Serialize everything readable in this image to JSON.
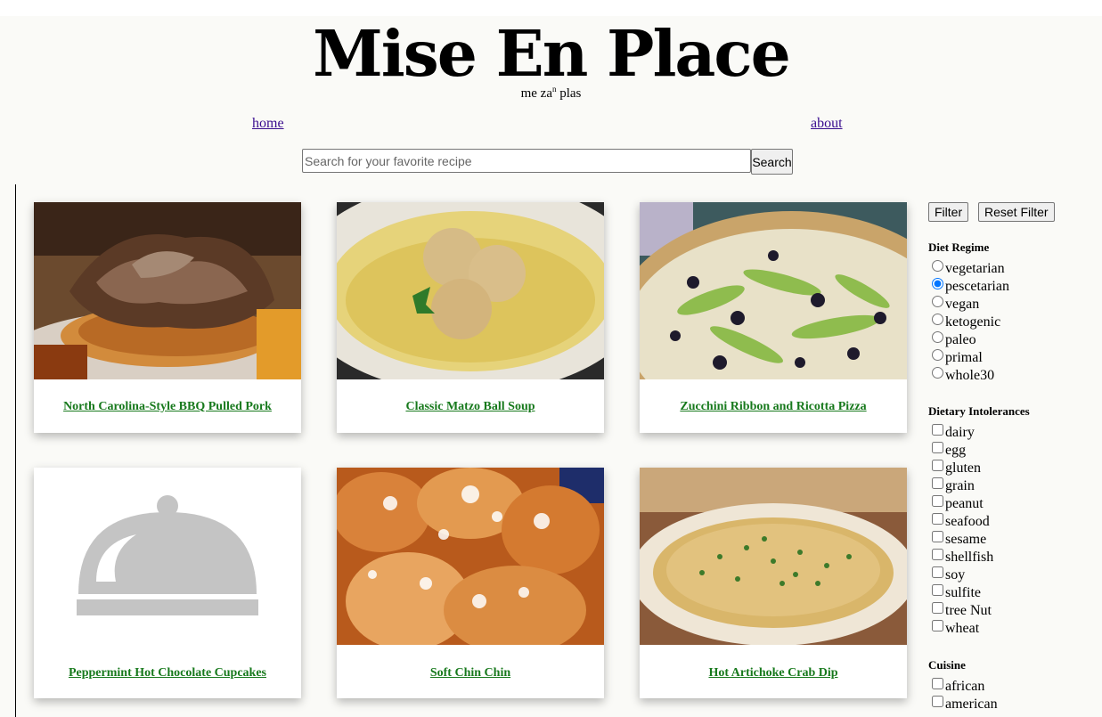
{
  "header": {
    "title": "Mise En Place",
    "pronunciation_main": "me za",
    "pronunciation_sup": "n",
    "pronunciation_end": "plas"
  },
  "nav": {
    "home": "home",
    "about": "about"
  },
  "search": {
    "placeholder": "Search for your favorite recipe",
    "value": "",
    "button": "Search"
  },
  "recipes": [
    {
      "title": "North Carolina-Style BBQ Pulled Pork",
      "image": "pulled-pork-photo"
    },
    {
      "title": "Classic Matzo Ball Soup",
      "image": "matzo-ball-soup-photo"
    },
    {
      "title": "Zucchini Ribbon and Ricotta Pizza",
      "image": "zucchini-pizza-photo"
    },
    {
      "title": "Peppermint Hot Chocolate Cupcakes",
      "image": "placeholder-cloche-icon"
    },
    {
      "title": "Soft Chin Chin",
      "image": "chin-chin-photo"
    },
    {
      "title": "Hot Artichoke Crab Dip",
      "image": "crab-dip-photo"
    }
  ],
  "filters": {
    "filter_button": "Filter",
    "reset_button": "Reset Filter",
    "diet": {
      "heading": "Diet Regime",
      "options": [
        "vegetarian",
        "pescetarian",
        "vegan",
        "ketogenic",
        "paleo",
        "primal",
        "whole30"
      ],
      "selected": "pescetarian"
    },
    "intolerances": {
      "heading": "Dietary Intolerances",
      "options": [
        "dairy",
        "egg",
        "gluten",
        "grain",
        "peanut",
        "seafood",
        "sesame",
        "shellfish",
        "soy",
        "sulfite",
        "tree Nut",
        "wheat"
      ]
    },
    "cuisine": {
      "heading": "Cuisine",
      "options": [
        "african",
        "american"
      ]
    }
  },
  "colors": {
    "link": "#3a0d8f",
    "recipe_link": "#17791c",
    "radio_selected": "#1a73e8"
  }
}
